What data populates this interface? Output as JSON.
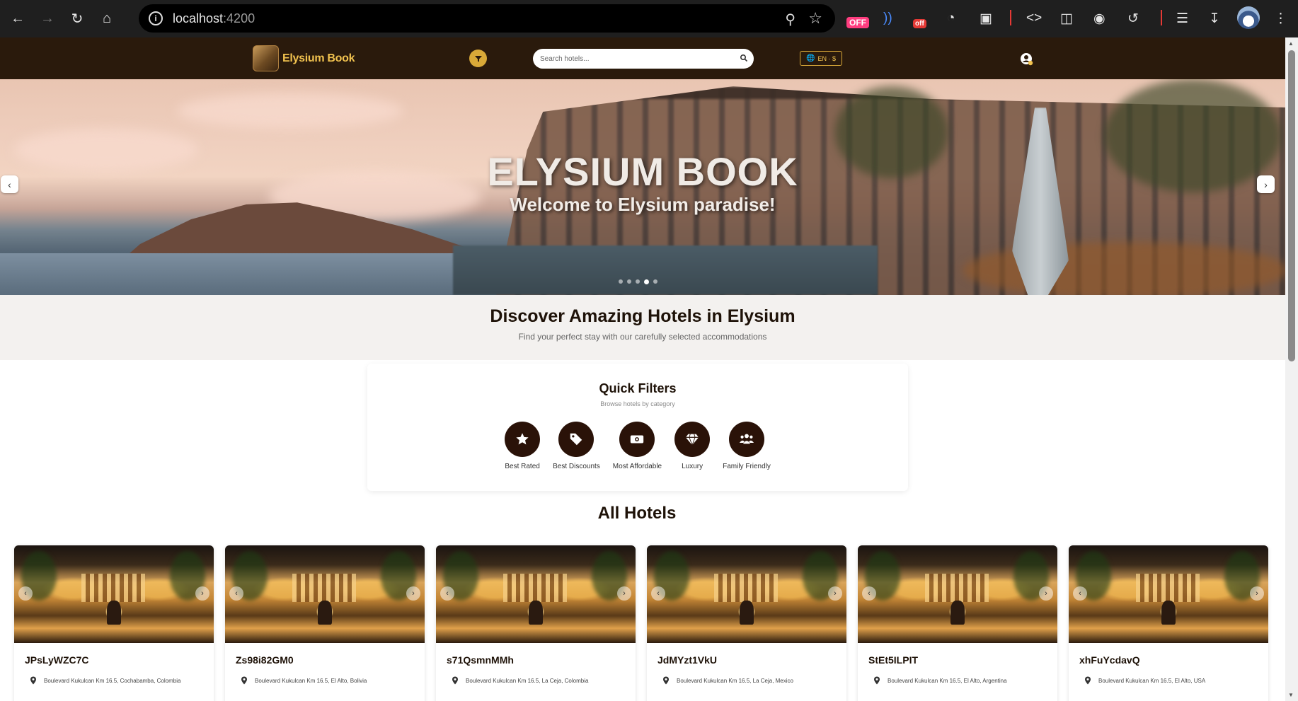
{
  "browser": {
    "url_host": "localhost",
    "url_port": ":4200",
    "ext_off_1": "OFF",
    "ext_off_2": "off"
  },
  "header": {
    "brand": "Elysium Book",
    "search_placeholder": "Search hotels...",
    "language": "EN · $"
  },
  "hero": {
    "title": "ELYSIUM BOOK",
    "subtitle": "Welcome to Elysium paradise!",
    "slide_count": 5,
    "active_slide": 4
  },
  "discover": {
    "title": "Discover Amazing Hotels in Elysium",
    "subtitle": "Find your perfect stay with our carefully selected accommodations"
  },
  "quick_filters": {
    "title": "Quick Filters",
    "subtitle": "Browse hotels by category",
    "categories": [
      {
        "label": "Best Rated",
        "icon": "star-icon"
      },
      {
        "label": "Best Discounts",
        "icon": "tag-icon"
      },
      {
        "label": "Most Affordable",
        "icon": "money-icon"
      },
      {
        "label": "Luxury",
        "icon": "diamond-icon"
      },
      {
        "label": "Family Friendly",
        "icon": "family-icon"
      }
    ]
  },
  "hotels": {
    "title": "All Hotels",
    "items": [
      {
        "name": "JPsLyWZC7C",
        "address": "Boulevard Kukulcan Km 16.5, Cochabamba, Colombia"
      },
      {
        "name": "Zs98i82GM0",
        "address": "Boulevard Kukulcan Km 16.5, El Alto, Bolivia"
      },
      {
        "name": "s71QsmnMMh",
        "address": "Boulevard Kukulcan Km 16.5, La Ceja, Colombia"
      },
      {
        "name": "JdMYzt1VkU",
        "address": "Boulevard Kukulcan Km 16.5, La Ceja, Mexico"
      },
      {
        "name": "StEt5ILPIT",
        "address": "Boulevard Kukulcan Km 16.5, El Alto, Argentina"
      },
      {
        "name": "xhFuYcdavQ",
        "address": "Boulevard Kukulcan Km 16.5, El Alto, USA"
      }
    ]
  },
  "colors": {
    "header_bg": "#2a1a0c",
    "brand_gold": "#f1c24f",
    "accent_gold": "#d9a938",
    "category_circle": "#2a1208"
  }
}
